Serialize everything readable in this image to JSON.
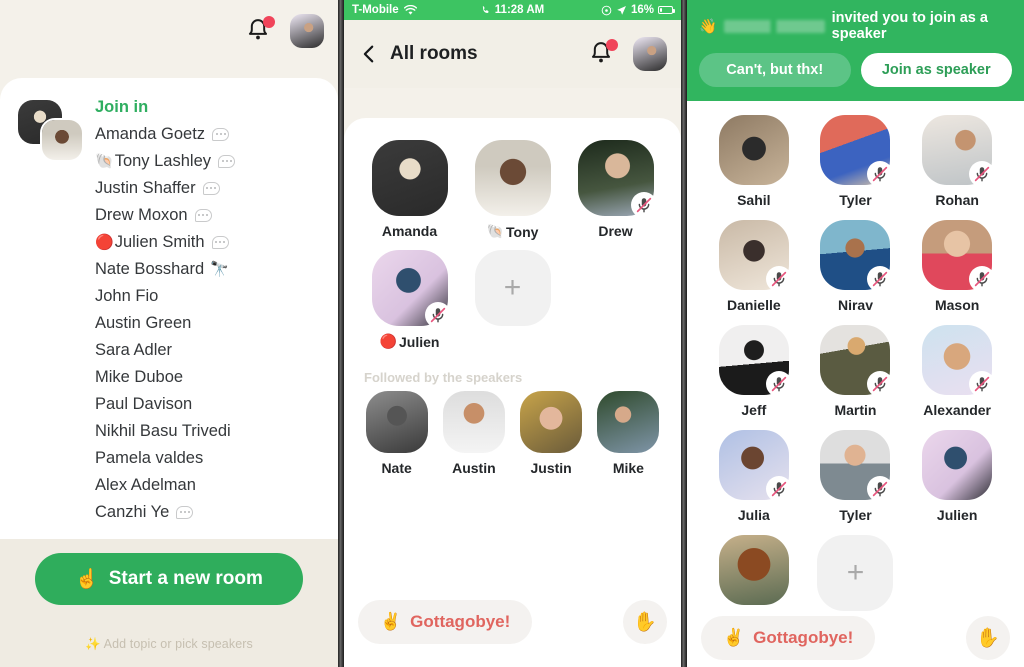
{
  "colors": {
    "brand_green": "#2FAD5C",
    "status_green": "#3DC462",
    "banner_green": "#31B55F",
    "leave_red": "#E0655F",
    "cream": "#F4F1EA",
    "footer_cream": "#EFEBE2"
  },
  "left_panel": {
    "bell_icon": "bell-icon",
    "notification_badge": true,
    "profile_icon": "profile-avatar",
    "join_in_label": "Join in",
    "people": [
      {
        "emoji": "",
        "name": "Amanda Goetz",
        "has_bubble": true
      },
      {
        "emoji": "🐚",
        "name": "Tony Lashley",
        "has_bubble": true
      },
      {
        "emoji": "",
        "name": "Justin Shaffer",
        "has_bubble": true
      },
      {
        "emoji": "",
        "name": "Drew Moxon",
        "has_bubble": true
      },
      {
        "emoji": "🔴",
        "name": "Julien Smith",
        "has_bubble": true
      },
      {
        "emoji": "",
        "name": "Nate Bosshard",
        "has_bubble": false,
        "suffix_emoji": "🔭"
      },
      {
        "emoji": "",
        "name": "John Fio",
        "has_bubble": false
      },
      {
        "emoji": "",
        "name": "Austin Green",
        "has_bubble": false
      },
      {
        "emoji": "",
        "name": "Sara Adler",
        "has_bubble": false
      },
      {
        "emoji": "",
        "name": "Mike Duboe",
        "has_bubble": false
      },
      {
        "emoji": "",
        "name": "Paul Davison",
        "has_bubble": false
      },
      {
        "emoji": "",
        "name": "Nikhil Basu Trivedi",
        "has_bubble": false
      },
      {
        "emoji": "",
        "name": "Pamela valdes",
        "has_bubble": false
      },
      {
        "emoji": "",
        "name": "Alex Adelman",
        "has_bubble": false
      },
      {
        "emoji": "",
        "name": "Canzhi Ye",
        "has_bubble": true
      }
    ],
    "start_room_emoji": "☝️",
    "start_room_label": "Start a new room",
    "hint_text": "✨ Add topic or pick speakers"
  },
  "mid_panel": {
    "status_bar": {
      "carrier": "T-Mobile",
      "wifi_icon": "wifi-icon",
      "call_icon": "phone-call-icon",
      "time": "11:28 AM",
      "location_icon": "location-arrow-icon",
      "lock_icon": "rotation-lock-icon",
      "battery": "16%"
    },
    "back_icon": "chevron-left-icon",
    "title": "All rooms",
    "bell_icon": "bell-icon",
    "notification_badge": true,
    "profile_icon": "profile-avatar",
    "speakers": [
      {
        "name": "Amanda",
        "emoji": "",
        "muted": false,
        "photo": "ph-amanda"
      },
      {
        "name": "Tony",
        "emoji": "🐚",
        "muted": false,
        "photo": "ph-tony"
      },
      {
        "name": "Drew",
        "emoji": "",
        "muted": true,
        "photo": "ph-drew"
      },
      {
        "name": "Julien",
        "emoji": "🔴",
        "muted": true,
        "photo": "ph-julien"
      }
    ],
    "add_speaker_icon": "plus-icon",
    "followed_label": "Followed by the speakers",
    "followers": [
      {
        "name": "Nate",
        "photo": "ph-nate"
      },
      {
        "name": "Austin",
        "photo": "ph-austin"
      },
      {
        "name": "Justin",
        "photo": "ph-justin"
      },
      {
        "name": "Mike",
        "photo": "ph-mike"
      }
    ],
    "leave_emoji": "✌️",
    "leave_label": "Gottagobye!",
    "raise_hand_emoji": "✋"
  },
  "right_panel": {
    "invite": {
      "emoji": "👋",
      "inviter_name_redacted": true,
      "message": "invited you to join as a speaker",
      "decline_label": "Can't, but thx!",
      "accept_label": "Join as speaker"
    },
    "participants": [
      {
        "name": "Sahil",
        "muted": false,
        "photo": "ph-sahil"
      },
      {
        "name": "Tyler",
        "muted": true,
        "photo": "ph-tyler"
      },
      {
        "name": "Rohan",
        "muted": true,
        "photo": "ph-rohan"
      },
      {
        "name": "Danielle",
        "muted": true,
        "photo": "ph-danielle"
      },
      {
        "name": "Nirav",
        "muted": true,
        "photo": "ph-nirav"
      },
      {
        "name": "Mason",
        "muted": true,
        "photo": "ph-mason"
      },
      {
        "name": "Jeff",
        "muted": true,
        "photo": "ph-jeff"
      },
      {
        "name": "Martin",
        "muted": true,
        "photo": "ph-martin"
      },
      {
        "name": "Alexander",
        "muted": true,
        "photo": "ph-alex"
      },
      {
        "name": "Julia",
        "muted": true,
        "photo": "ph-julia"
      },
      {
        "name": "Tyler",
        "muted": true,
        "photo": "ph-tyler2"
      },
      {
        "name": "Julien",
        "muted": false,
        "photo": "ph-julien"
      },
      {
        "name": "",
        "muted": false,
        "photo": "ph-hat"
      }
    ],
    "add_speaker_icon": "plus-icon",
    "leave_emoji": "✌️",
    "leave_label": "Gottagobye!",
    "raise_hand_emoji": "✋"
  }
}
